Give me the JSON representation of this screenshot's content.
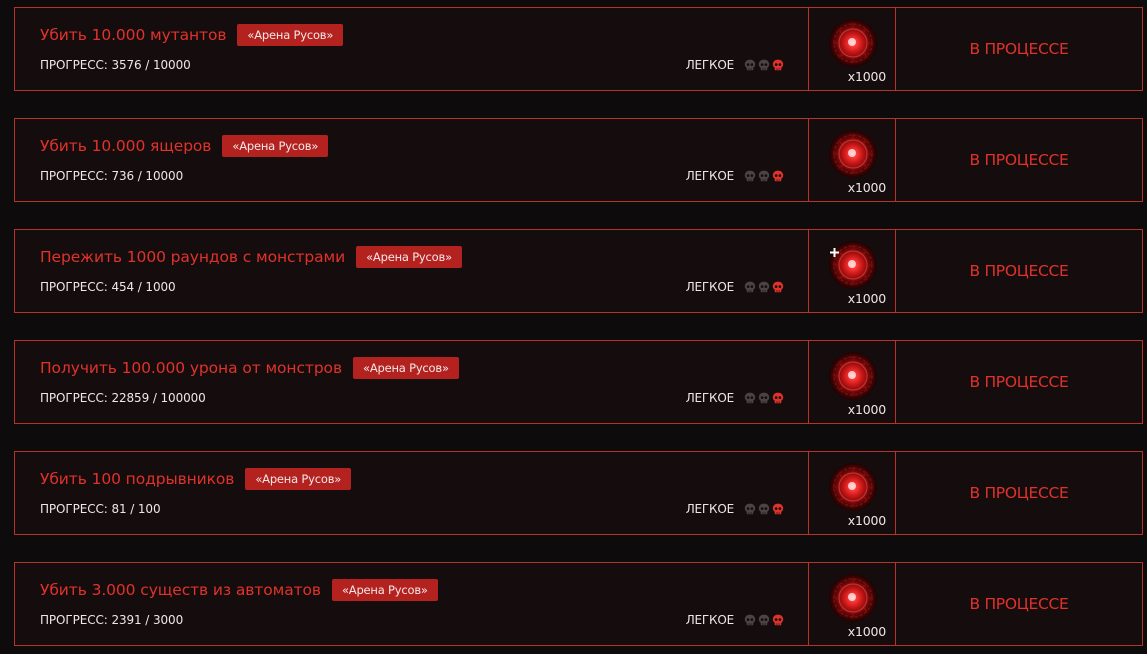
{
  "colors": {
    "accent": "#e0322b",
    "border": "#b8322c",
    "tag_bg": "#b3221f",
    "card_bg": "#150d0d",
    "page_bg": "#0d0b0b",
    "skull_inactive": "#4a4444",
    "skull_active": "#e0322b"
  },
  "quests": [
    {
      "title": "Убить 10.000 мутантов",
      "tag": "«Арена Русов»",
      "progress_label": "ПРОГРЕСС: 3576 / 10000",
      "progress_current": 3576,
      "progress_total": 10000,
      "difficulty": "ЛЕГКОЕ",
      "difficulty_level": 1,
      "reward_icon": "red-orb-icon",
      "reward_amount": "x1000",
      "status": "В ПРОЦЕССЕ"
    },
    {
      "title": "Убить 10.000 ящеров",
      "tag": "«Арена Русов»",
      "progress_label": "ПРОГРЕСС: 736 / 10000",
      "progress_current": 736,
      "progress_total": 10000,
      "difficulty": "ЛЕГКОЕ",
      "difficulty_level": 1,
      "reward_icon": "red-orb-icon",
      "reward_amount": "x1000",
      "status": "В ПРОЦЕССЕ"
    },
    {
      "title": "Пережить 1000 раундов с монстрами",
      "tag": "«Арена Русов»",
      "progress_label": "ПРОГРЕСС: 454 / 1000",
      "progress_current": 454,
      "progress_total": 1000,
      "difficulty": "ЛЕГКОЕ",
      "difficulty_level": 1,
      "reward_icon": "red-orb-icon",
      "reward_amount": "x1000",
      "status": "В ПРОЦЕССЕ"
    },
    {
      "title": "Получить 100.000 урона от монстров",
      "tag": "«Арена Русов»",
      "progress_label": "ПРОГРЕСС: 22859 / 100000",
      "progress_current": 22859,
      "progress_total": 100000,
      "difficulty": "ЛЕГКОЕ",
      "difficulty_level": 1,
      "reward_icon": "red-orb-icon",
      "reward_amount": "x1000",
      "status": "В ПРОЦЕССЕ"
    },
    {
      "title": "Убить 100 подрывников",
      "tag": "«Арена Русов»",
      "progress_label": "ПРОГРЕСС: 81 / 100",
      "progress_current": 81,
      "progress_total": 100,
      "difficulty": "ЛЕГКОЕ",
      "difficulty_level": 1,
      "reward_icon": "red-orb-icon",
      "reward_amount": "x1000",
      "status": "В ПРОЦЕССЕ"
    },
    {
      "title": "Убить 3.000 существ из автоматов",
      "tag": "«Арена Русов»",
      "progress_label": "ПРОГРЕСС: 2391 / 3000",
      "progress_current": 2391,
      "progress_total": 3000,
      "difficulty": "ЛЕГКОЕ",
      "difficulty_level": 1,
      "reward_icon": "red-orb-icon",
      "reward_amount": "x1000",
      "status": "В ПРОЦЕССЕ"
    }
  ]
}
